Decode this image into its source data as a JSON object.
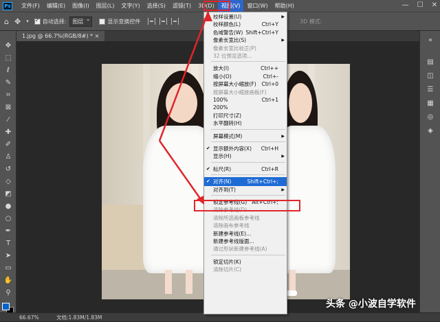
{
  "app": {
    "logo": "Ps"
  },
  "menubar": {
    "items": [
      "文件(F)",
      "编辑(E)",
      "图像(I)",
      "图层(L)",
      "文字(Y)",
      "选择(S)",
      "滤镜(T)",
      "3D(D)",
      "视图(V)",
      "窗口(W)",
      "帮助(H)"
    ],
    "active_index": 8
  },
  "window_controls": {
    "minimize": "—",
    "maximize": "☐",
    "close": "✕"
  },
  "options_bar": {
    "home_icon": "home-icon",
    "move_icon": "move-icon",
    "auto_select_label": "自动选择:",
    "auto_select_checked": true,
    "auto_select_value": "图层",
    "transform_controls_label": "显示变换控件",
    "transform_controls_checked": false,
    "mode_3d_label": "3D 模式:"
  },
  "document_tab": {
    "title": "1.jpg @ 66.7%(RGB/8#) * ×"
  },
  "view_menu": {
    "items": [
      {
        "label": "校样设置(U)",
        "submenu": true,
        "enabled": true
      },
      {
        "label": "校样颜色(L)",
        "shortcut": "Ctrl+Y",
        "enabled": true
      },
      {
        "label": "色域警告(W)",
        "shortcut": "Shift+Ctrl+Y",
        "enabled": true
      },
      {
        "label": "像素长宽比(S)",
        "submenu": true,
        "enabled": true
      },
      {
        "label": "像素长宽比校正(P)",
        "enabled": false
      },
      {
        "label": "32 位预览选项...",
        "enabled": false
      },
      {
        "separator": true
      },
      {
        "label": "放大(I)",
        "shortcut": "Ctrl++",
        "enabled": true
      },
      {
        "label": "缩小(O)",
        "shortcut": "Ctrl+-",
        "enabled": true
      },
      {
        "label": "按屏幕大小缩放(F)",
        "shortcut": "Ctrl+0",
        "enabled": true
      },
      {
        "label": "按屏幕大小缩放画板(F)",
        "enabled": false
      },
      {
        "label": "100%",
        "shortcut": "Ctrl+1",
        "enabled": true
      },
      {
        "label": "200%",
        "enabled": true
      },
      {
        "label": "打印尺寸(Z)",
        "enabled": true
      },
      {
        "label": "水平翻转(H)",
        "enabled": true
      },
      {
        "separator": true
      },
      {
        "label": "屏幕模式(M)",
        "submenu": true,
        "enabled": true
      },
      {
        "separator": true
      },
      {
        "label": "显示额外内容(X)",
        "shortcut": "Ctrl+H",
        "checked": true,
        "enabled": true
      },
      {
        "label": "显示(H)",
        "submenu": true,
        "enabled": true
      },
      {
        "separator": true
      },
      {
        "label": "标尺(R)",
        "shortcut": "Ctrl+R",
        "checked": true,
        "enabled": true
      },
      {
        "separator": true
      },
      {
        "label": "对齐(N)",
        "shortcut": "Shift+Ctrl+;",
        "checked": true,
        "enabled": true,
        "highlighted": true
      },
      {
        "label": "对齐到(T)",
        "submenu": true,
        "enabled": true
      },
      {
        "separator": true
      },
      {
        "label": "锁定参考线(G)",
        "shortcut": "Alt+Ctrl+;",
        "enabled": true
      },
      {
        "label": "清除参考线(D)",
        "enabled": false
      },
      {
        "label": "清除所选画板参考线",
        "enabled": false
      },
      {
        "label": "清除画布参考线",
        "enabled": false
      },
      {
        "label": "新建参考线(E)...",
        "enabled": true
      },
      {
        "label": "新建参考线版面...",
        "enabled": true
      },
      {
        "label": "通过形状新建参考线(A)",
        "enabled": false
      },
      {
        "separator": true
      },
      {
        "label": "锁定切片(K)",
        "enabled": true
      },
      {
        "label": "清除切片(C)",
        "enabled": false
      }
    ]
  },
  "status_bar": {
    "zoom": "66.67%",
    "doc_info": "文档:1.83M/1.83M"
  },
  "watermark": {
    "text": "头条 @小波自学软件"
  },
  "colors": {
    "highlight": "#1e6bd4",
    "annotation_red": "#e0262a",
    "foreground": "#0064c8",
    "background": "#000000"
  }
}
